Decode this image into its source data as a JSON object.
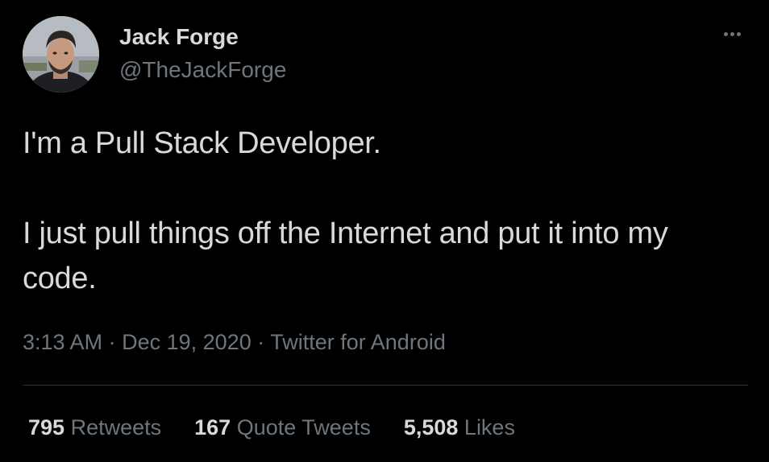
{
  "author": {
    "display_name": "Jack Forge",
    "handle": "@TheJackForge",
    "avatar_icon": "profile-photo"
  },
  "more_icon": "more-horizontal-icon",
  "tweet": {
    "paragraphs": [
      "I'm a Pull Stack Developer.",
      "I just pull things off the Internet and put it into my code."
    ]
  },
  "meta": {
    "time": "3:13 AM",
    "separator": "·",
    "date": "Dec 19, 2020",
    "source": "Twitter for Android"
  },
  "stats": {
    "retweets": {
      "count": "795",
      "label": "Retweets"
    },
    "quote_tweets": {
      "count": "167",
      "label": "Quote Tweets"
    },
    "likes": {
      "count": "5,508",
      "label": "Likes"
    }
  },
  "colors": {
    "background": "#000000",
    "primary_text": "#d9d9d9",
    "secondary_text": "#6e767d",
    "divider": "#2f3336"
  }
}
